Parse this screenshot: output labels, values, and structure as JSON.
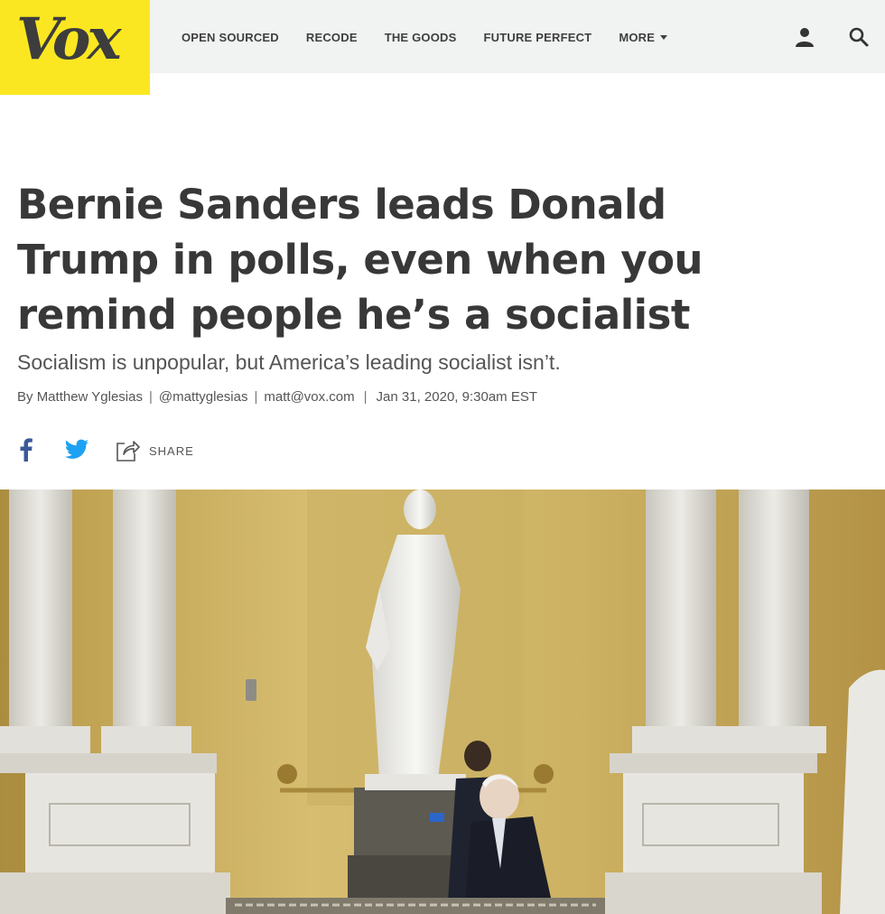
{
  "brand": {
    "logo_text": "Vox",
    "logo_bg": "#fbe721"
  },
  "nav": {
    "links": [
      "Open Sourced",
      "Recode",
      "The Goods",
      "Future Perfect"
    ],
    "more_label": "More",
    "icons": [
      "user-icon",
      "search-icon"
    ]
  },
  "article": {
    "headline": "Bernie Sanders leads Donald Trump in polls, even when you remind people he’s a socialist",
    "dek": "Socialism is unpopular, but America’s leading socialist isn’t.",
    "byline": {
      "by_prefix": "By",
      "author": "Matthew Yglesias",
      "twitter": "@mattyglesias",
      "email": "matt@vox.com",
      "date": "Jan 31, 2020, 9:30am EST"
    }
  },
  "share": {
    "label": "SHARE",
    "icons": [
      "facebook-icon",
      "twitter-icon",
      "share-icon"
    ],
    "facebook_color": "#3b5998",
    "twitter_color": "#1da1f2"
  },
  "hero_image": {
    "subject": "photo-hero"
  }
}
